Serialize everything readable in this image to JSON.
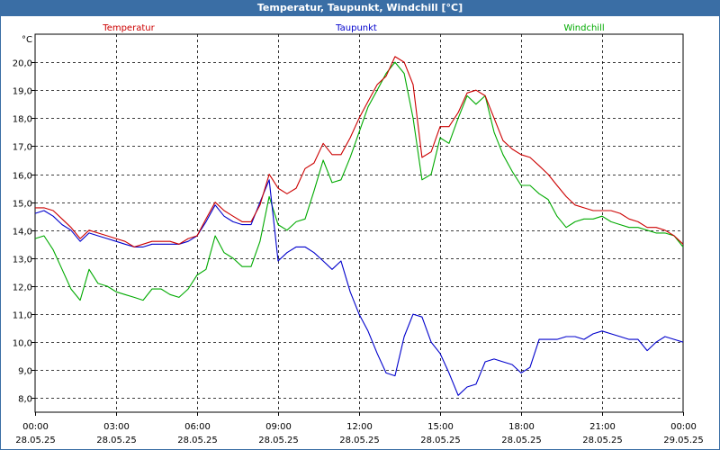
{
  "window": {
    "title": "Temperatur, Taupunkt, Windchill [°C]"
  },
  "chart_data": {
    "type": "line",
    "title": "Temperatur, Taupunkt, Windchill [°C]",
    "ylabel": "°C",
    "xlim": [
      0,
      24
    ],
    "ylim": [
      7.5,
      21.0
    ],
    "grid": true,
    "legend_placement": "top",
    "y_ticks": [
      "8,0",
      "9,0",
      "10,0",
      "11,0",
      "12,0",
      "13,0",
      "14,0",
      "15,0",
      "16,0",
      "17,0",
      "18,0",
      "19,0",
      "20,0"
    ],
    "x_ticks": [
      {
        "time": "00:00",
        "date": "28.05.25"
      },
      {
        "time": "03:00",
        "date": "28.05.25"
      },
      {
        "time": "06:00",
        "date": "28.05.25"
      },
      {
        "time": "09:00",
        "date": "28.05.25"
      },
      {
        "time": "12:00",
        "date": "28.05.25"
      },
      {
        "time": "15:00",
        "date": "28.05.25"
      },
      {
        "time": "18:00",
        "date": "28.05.25"
      },
      {
        "time": "21:00",
        "date": "28.05.25"
      },
      {
        "time": "00:00",
        "date": "29.05.25"
      }
    ],
    "series": [
      {
        "name": "Temperatur",
        "color": "#cc0000",
        "x": [
          0.0,
          0.33,
          0.67,
          1.0,
          1.33,
          1.67,
          2.0,
          2.33,
          2.67,
          3.0,
          3.33,
          3.67,
          4.0,
          4.33,
          4.67,
          5.0,
          5.33,
          5.67,
          6.0,
          6.33,
          6.67,
          7.0,
          7.33,
          7.67,
          8.0,
          8.33,
          8.67,
          9.0,
          9.33,
          9.67,
          10.0,
          10.33,
          10.67,
          11.0,
          11.33,
          11.67,
          12.0,
          12.33,
          12.67,
          13.0,
          13.33,
          13.67,
          14.0,
          14.33,
          14.67,
          15.0,
          15.33,
          15.67,
          16.0,
          16.33,
          16.67,
          17.0,
          17.33,
          17.67,
          18.0,
          18.33,
          18.67,
          19.0,
          19.33,
          19.67,
          20.0,
          20.33,
          20.67,
          21.0,
          21.33,
          21.67,
          22.0,
          22.33,
          22.67,
          23.0,
          23.33,
          23.67,
          24.0
        ],
        "values": [
          14.8,
          14.8,
          14.7,
          14.4,
          14.1,
          13.7,
          14.0,
          13.9,
          13.8,
          13.7,
          13.6,
          13.4,
          13.5,
          13.6,
          13.6,
          13.6,
          13.5,
          13.7,
          13.8,
          14.4,
          15.0,
          14.7,
          14.5,
          14.3,
          14.3,
          14.9,
          16.0,
          15.5,
          15.3,
          15.5,
          16.2,
          16.4,
          17.1,
          16.7,
          16.7,
          17.3,
          18.0,
          18.6,
          19.2,
          19.5,
          20.2,
          20.0,
          19.2,
          16.6,
          16.8,
          17.7,
          17.7,
          18.2,
          18.9,
          19.0,
          18.8,
          18.0,
          17.2,
          16.9,
          16.7,
          16.6,
          16.3,
          16.0,
          15.6,
          15.2,
          14.9,
          14.8,
          14.7,
          14.7,
          14.7,
          14.6,
          14.4,
          14.3,
          14.1,
          14.1,
          14.0,
          13.8,
          13.5
        ]
      },
      {
        "name": "Taupunkt",
        "color": "#0000cc",
        "x": [
          0.0,
          0.33,
          0.67,
          1.0,
          1.33,
          1.67,
          2.0,
          2.33,
          2.67,
          3.0,
          3.33,
          3.67,
          4.0,
          4.33,
          4.67,
          5.0,
          5.33,
          5.67,
          6.0,
          6.33,
          6.67,
          7.0,
          7.33,
          7.67,
          8.0,
          8.33,
          8.67,
          9.0,
          9.33,
          9.67,
          10.0,
          10.33,
          10.67,
          11.0,
          11.33,
          11.67,
          12.0,
          12.33,
          12.67,
          13.0,
          13.33,
          13.67,
          14.0,
          14.33,
          14.67,
          15.0,
          15.33,
          15.67,
          16.0,
          16.33,
          16.67,
          17.0,
          17.33,
          17.67,
          18.0,
          18.33,
          18.67,
          19.0,
          19.33,
          19.67,
          20.0,
          20.33,
          20.67,
          21.0,
          21.33,
          21.67,
          22.0,
          22.33,
          22.67,
          23.0,
          23.33,
          23.67,
          24.0
        ],
        "values": [
          14.6,
          14.7,
          14.5,
          14.2,
          14.0,
          13.6,
          13.9,
          13.8,
          13.7,
          13.6,
          13.5,
          13.4,
          13.4,
          13.5,
          13.5,
          13.5,
          13.5,
          13.6,
          13.8,
          14.3,
          14.9,
          14.5,
          14.3,
          14.2,
          14.2,
          15.0,
          15.8,
          12.9,
          13.2,
          13.4,
          13.4,
          13.2,
          12.9,
          12.6,
          12.9,
          11.8,
          11.0,
          10.4,
          9.6,
          8.9,
          8.8,
          10.2,
          11.0,
          10.9,
          10.0,
          9.6,
          8.9,
          8.1,
          8.4,
          8.5,
          9.3,
          9.4,
          9.3,
          9.2,
          8.9,
          9.1,
          10.1,
          10.1,
          10.1,
          10.2,
          10.2,
          10.1,
          10.3,
          10.4,
          10.3,
          10.2,
          10.1,
          10.1,
          9.7,
          10.0,
          10.2,
          10.1,
          10.0
        ]
      },
      {
        "name": "Windchill",
        "color": "#00aa00",
        "x": [
          0.0,
          0.33,
          0.67,
          1.0,
          1.33,
          1.67,
          2.0,
          2.33,
          2.67,
          3.0,
          3.33,
          3.67,
          4.0,
          4.33,
          4.67,
          5.0,
          5.33,
          5.67,
          6.0,
          6.33,
          6.67,
          7.0,
          7.33,
          7.67,
          8.0,
          8.33,
          8.67,
          9.0,
          9.33,
          9.67,
          10.0,
          10.33,
          10.67,
          11.0,
          11.33,
          11.67,
          12.0,
          12.33,
          12.67,
          13.0,
          13.33,
          13.67,
          14.0,
          14.33,
          14.67,
          15.0,
          15.33,
          15.67,
          16.0,
          16.33,
          16.67,
          17.0,
          17.33,
          17.67,
          18.0,
          18.33,
          18.67,
          19.0,
          19.33,
          19.67,
          20.0,
          20.33,
          20.67,
          21.0,
          21.33,
          21.67,
          22.0,
          22.33,
          22.67,
          23.0,
          23.33,
          23.67,
          24.0
        ],
        "values": [
          13.7,
          13.8,
          13.3,
          12.6,
          11.9,
          11.5,
          12.6,
          12.1,
          12.0,
          11.8,
          11.7,
          11.6,
          11.5,
          11.9,
          11.9,
          11.7,
          11.6,
          11.9,
          12.4,
          12.6,
          13.8,
          13.2,
          13.0,
          12.7,
          12.7,
          13.6,
          15.2,
          14.2,
          14.0,
          14.3,
          14.4,
          15.4,
          16.5,
          15.7,
          15.8,
          16.6,
          17.5,
          18.4,
          19.0,
          19.6,
          20.0,
          19.6,
          18.0,
          15.8,
          16.0,
          17.3,
          17.1,
          18.0,
          18.8,
          18.5,
          18.8,
          17.5,
          16.7,
          16.1,
          15.6,
          15.6,
          15.3,
          15.1,
          14.5,
          14.1,
          14.3,
          14.4,
          14.4,
          14.5,
          14.3,
          14.2,
          14.1,
          14.1,
          14.0,
          13.9,
          13.9,
          13.8,
          13.4
        ]
      }
    ]
  }
}
